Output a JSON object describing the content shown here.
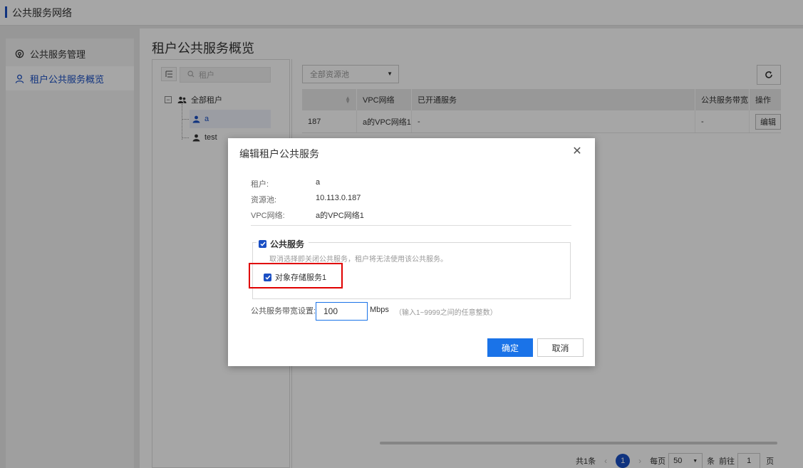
{
  "header": {
    "title": "公共服务网络"
  },
  "sidebar": {
    "items": [
      {
        "label": "公共服务管理",
        "icon": "service-icon"
      },
      {
        "label": "租户公共服务概览",
        "icon": "user-icon"
      }
    ]
  },
  "page": {
    "title": "租户公共服务概览"
  },
  "tree": {
    "search_placeholder": "租户",
    "root": "全部租户",
    "children": [
      "a",
      "test"
    ]
  },
  "toolbar": {
    "pool_placeholder": "全部资源池"
  },
  "table": {
    "columns": [
      "",
      "VPC网络",
      "已开通服务",
      "公共服务带宽",
      "操作"
    ],
    "rows": [
      {
        "pool": "187",
        "vpc": "a的VPC网络1",
        "services": "-",
        "bandwidth": "-",
        "action": "编辑"
      }
    ]
  },
  "pager": {
    "total": "共1条",
    "current": "1",
    "per_page_label": "每页",
    "per_page": "50",
    "per_page_unit": "条",
    "goto_label": "前往",
    "goto_value": "1",
    "goto_unit": "页"
  },
  "dialog": {
    "title": "编辑租户公共服务",
    "info": [
      {
        "label": "租户:",
        "value": "a"
      },
      {
        "label": "资源池:",
        "value": "10.113.0.187"
      },
      {
        "label": "VPC网络:",
        "value": "a的VPC网络1"
      }
    ],
    "group_label": "公共服务",
    "group_hint": "取消选择即关闭公共服务，租户将无法使用该公共服务。",
    "service_item": "对象存储服务1",
    "bandwidth_label": "公共服务带宽设置:",
    "bandwidth_value": "100",
    "bandwidth_unit": "Mbps",
    "bandwidth_hint": "（输入1~9999之间的任意整数）",
    "ok_label": "确定",
    "cancel_label": "取消"
  },
  "colors": {
    "primary": "#1a73e8",
    "accent": "#1a4fc4",
    "highlight": "#e00000"
  }
}
